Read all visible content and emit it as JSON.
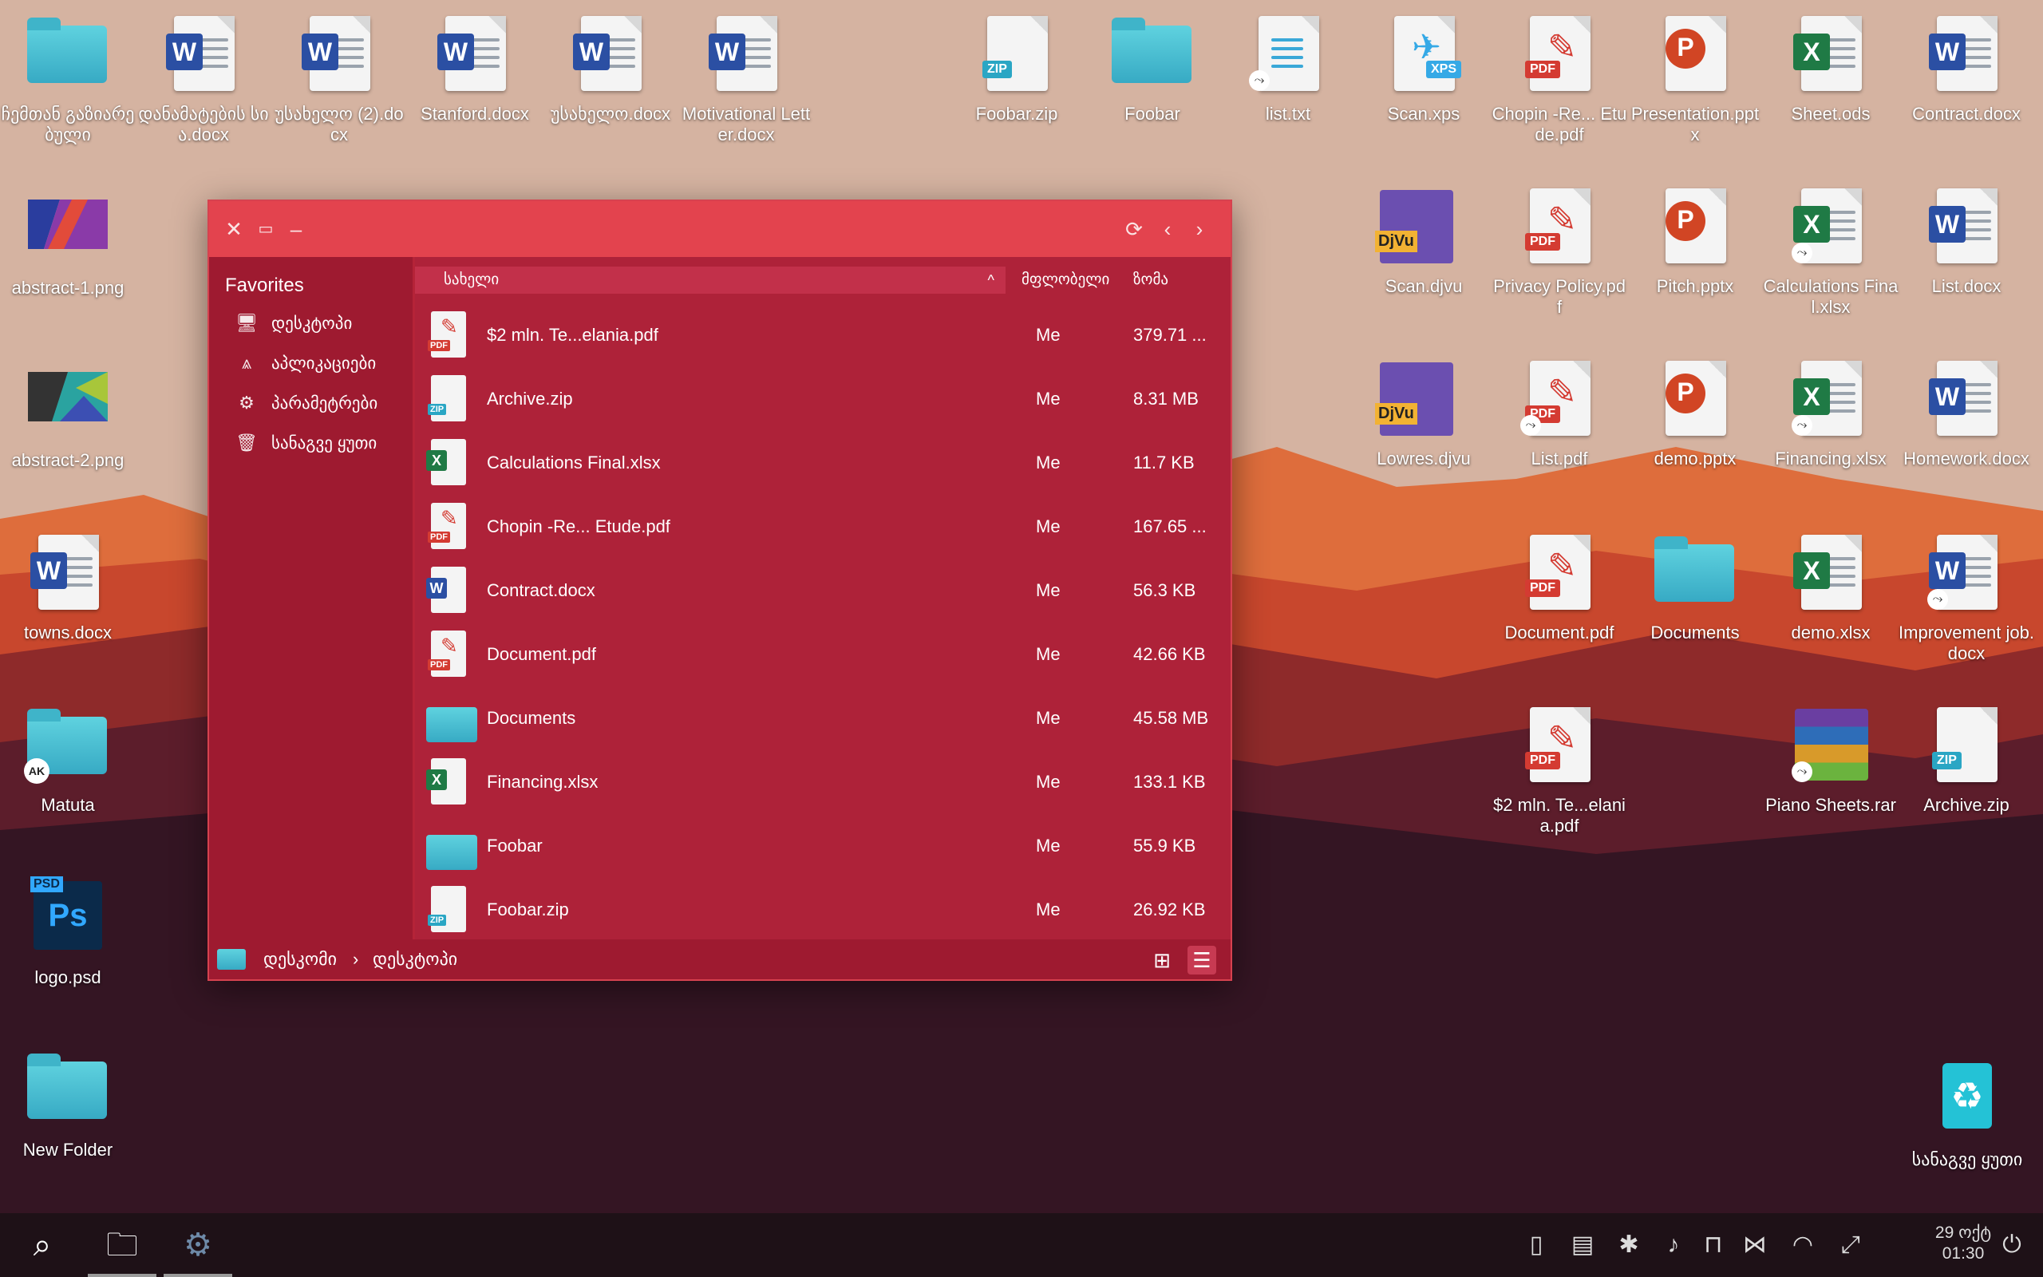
{
  "desktop": {
    "icons_left": [
      {
        "label": "ჩემთან გაზიარებული",
        "type": "folder"
      },
      {
        "label": "abstract-1.png",
        "type": "image"
      },
      {
        "label": "abstract-2.png",
        "type": "image"
      },
      {
        "label": "towns.docx",
        "type": "docx"
      },
      {
        "label": "Matuta",
        "type": "folder",
        "avatar": "AK"
      },
      {
        "label": "logo.psd",
        "type": "psd",
        "psd_tag": "PSD",
        "psd_letters": "Ps"
      },
      {
        "label": "New Folder",
        "type": "folder"
      }
    ],
    "icons_top": [
      {
        "label": "დანამატების სია.docx",
        "type": "docx"
      },
      {
        "label": "უსახელო (2).docx",
        "type": "docx"
      },
      {
        "label": "Stanford.docx",
        "type": "docx"
      },
      {
        "label": "უსახელო.docx",
        "type": "docx"
      },
      {
        "label": "Motivational Letter.docx",
        "type": "docx"
      },
      {
        "label": "Foobar.zip",
        "type": "zip"
      },
      {
        "label": "Foobar",
        "type": "folder"
      },
      {
        "label": "list.txt",
        "type": "txt"
      }
    ],
    "icons_right": [
      {
        "label": "Scan.xps",
        "type": "xps"
      },
      {
        "label": "Chopin -Re... Etude.pdf",
        "type": "pdf"
      },
      {
        "label": "Presentation.pptx",
        "type": "pptx"
      },
      {
        "label": "Sheet.ods",
        "type": "xlsx"
      },
      {
        "label": "Contract.docx",
        "type": "docx"
      },
      {
        "label": "Scan.djvu",
        "type": "djvu"
      },
      {
        "label": "Privacy Policy.pdf",
        "type": "pdf"
      },
      {
        "label": "Pitch.pptx",
        "type": "pptx"
      },
      {
        "label": "Calculations Final.xlsx",
        "type": "xlsx"
      },
      {
        "label": "List.docx",
        "type": "docx"
      },
      {
        "label": "Lowres.djvu",
        "type": "djvu"
      },
      {
        "label": "List.pdf",
        "type": "pdf"
      },
      {
        "label": "demo.pptx",
        "type": "pptx"
      },
      {
        "label": "Financing.xlsx",
        "type": "xlsx"
      },
      {
        "label": "Homework.docx",
        "type": "docx"
      },
      {
        "label": "Document.pdf",
        "type": "pdf"
      },
      {
        "label": "Documents",
        "type": "folder"
      },
      {
        "label": "demo.xlsx",
        "type": "xlsx"
      },
      {
        "label": "Improvement job.docx",
        "type": "docx"
      },
      {
        "label": "$2 mln. Te...elania.pdf",
        "type": "pdf"
      },
      {
        "label": "Piano Sheets.rar",
        "type": "rar"
      },
      {
        "label": "Archive.zip",
        "type": "zip"
      }
    ],
    "recycle_bin_label": "სანაგვე ყუთი",
    "badges": {
      "docx": "W",
      "xlsx": "X",
      "pptx": "P",
      "pdf": "PDF",
      "zip": "ZIP",
      "xps": "XPS",
      "djvu": "DjVu",
      "share": "⤳"
    }
  },
  "file_manager": {
    "sidebar": {
      "title": "Favorites",
      "items": [
        {
          "label": "დესკტოპი",
          "icon": "monitor-icon"
        },
        {
          "label": "აპლიკაციები",
          "icon": "apps-icon"
        },
        {
          "label": "პარამეტრები",
          "icon": "gear-icon"
        },
        {
          "label": "სანაგვე ყუთი",
          "icon": "trash-icon"
        }
      ]
    },
    "columns": {
      "name": "სახელი",
      "owner": "მფლობელი",
      "size": "ზომა"
    },
    "files": [
      {
        "name": "$2 mln. Te...elania.pdf",
        "owner": "Me",
        "size": "379.71 ...",
        "type": "pdf"
      },
      {
        "name": "Archive.zip",
        "owner": "Me",
        "size": "8.31 MB",
        "type": "zip"
      },
      {
        "name": "Calculations Final.xlsx",
        "owner": "Me",
        "size": "11.7 KB",
        "type": "xlsx"
      },
      {
        "name": "Chopin -Re... Etude.pdf",
        "owner": "Me",
        "size": "167.65 ...",
        "type": "pdf"
      },
      {
        "name": "Contract.docx",
        "owner": "Me",
        "size": "56.3 KB",
        "type": "docx"
      },
      {
        "name": "Document.pdf",
        "owner": "Me",
        "size": "42.66 KB",
        "type": "pdf"
      },
      {
        "name": "Documents",
        "owner": "Me",
        "size": "45.58 MB",
        "type": "folder"
      },
      {
        "name": "Financing.xlsx",
        "owner": "Me",
        "size": "133.1 KB",
        "type": "xlsx"
      },
      {
        "name": "Foobar",
        "owner": "Me",
        "size": "55.9 KB",
        "type": "folder"
      },
      {
        "name": "Foobar.zip",
        "owner": "Me",
        "size": "26.92 KB",
        "type": "zip"
      }
    ],
    "breadcrumb": [
      "დესკომი",
      "დესკტოპი"
    ]
  },
  "taskbar": {
    "clock": {
      "date": "29 ოქტ",
      "time": "01:30"
    }
  },
  "colors": {
    "titlebar": "#e3434e",
    "window": "#b52338",
    "sidebar": "#9e1a30",
    "taskbar": "#1e1117"
  }
}
